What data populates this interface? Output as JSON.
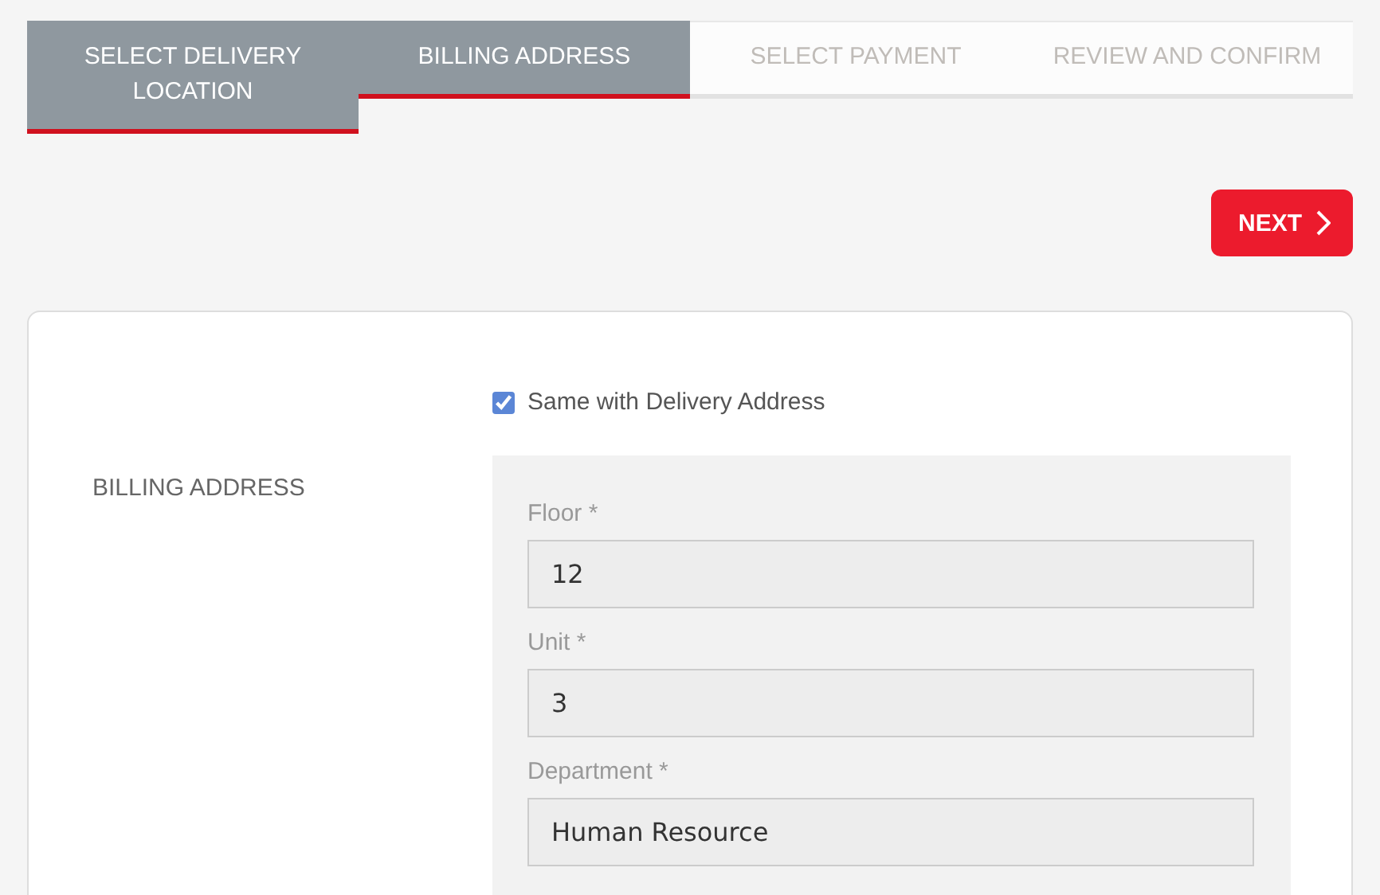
{
  "steps": [
    {
      "label": "SELECT DELIVERY LOCATION",
      "done": true
    },
    {
      "label": "BILLING ADDRESS",
      "done": true
    },
    {
      "label": "SELECT PAYMENT",
      "done": false
    },
    {
      "label": "REVIEW AND CONFIRM",
      "done": false
    }
  ],
  "next_button": {
    "label": "NEXT"
  },
  "billing": {
    "section_label": "BILLING ADDRESS",
    "same_as_delivery": {
      "label": "Same with Delivery Address",
      "checked": true
    },
    "fields": [
      {
        "label": "Floor *",
        "value": "12"
      },
      {
        "label": "Unit *",
        "value": "3"
      },
      {
        "label": "Department *",
        "value": "Human Resource"
      }
    ]
  }
}
